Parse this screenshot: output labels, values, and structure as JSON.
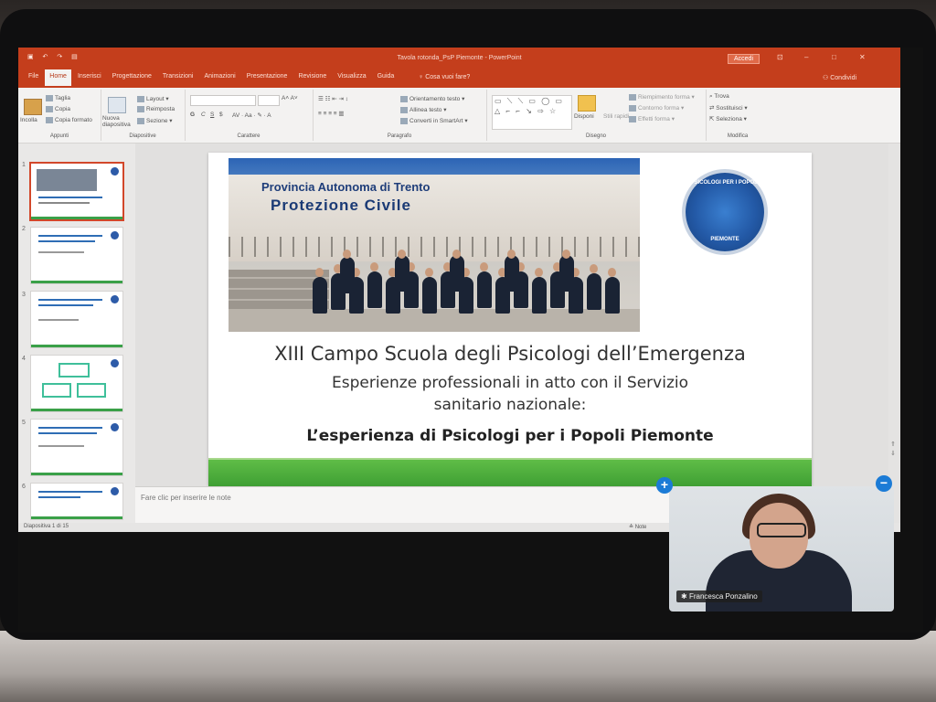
{
  "window": {
    "title": "Tavola rotonda_PsP Piemonte - PowerPoint",
    "signin_label": "Accedi",
    "share_label": "Condividi",
    "tell_me": "Cosa vuoi fare?"
  },
  "tabs": [
    {
      "label": "File"
    },
    {
      "label": "Home"
    },
    {
      "label": "Inserisci"
    },
    {
      "label": "Progettazione"
    },
    {
      "label": "Transizioni"
    },
    {
      "label": "Animazioni"
    },
    {
      "label": "Presentazione"
    },
    {
      "label": "Revisione"
    },
    {
      "label": "Visualizza"
    },
    {
      "label": "Guida"
    }
  ],
  "ribbon": {
    "clipboard": {
      "paste": "Incolla",
      "cut": "Taglia",
      "copy": "Copia",
      "format": "Copia formato",
      "group": "Appunti"
    },
    "slides": {
      "new": "Nuova diapositiva",
      "layout": "Layout",
      "reset": "Reimposta",
      "section": "Sezione",
      "group": "Diapositive"
    },
    "font": {
      "bold": "G",
      "italic": "C",
      "strike": "S",
      "shadow": "$",
      "group": "Carattere"
    },
    "paragraph": {
      "direction": "Orientamento testo",
      "align": "Allinea testo",
      "smartart": "Converti in SmartArt",
      "group": "Paragrafo"
    },
    "drawing": {
      "arrange": "Disponi",
      "styles": "Stili rapidi",
      "fill": "Riempimento forma",
      "outline": "Contorno forma",
      "effects": "Effetti forma",
      "group": "Disegno"
    },
    "editing": {
      "find": "Trova",
      "replace": "Sostituisci",
      "select": "Seleziona",
      "group": "Modifica"
    }
  },
  "thumbnails": [
    {
      "num": "1",
      "active": true
    },
    {
      "num": "2",
      "active": false
    },
    {
      "num": "3",
      "active": false
    },
    {
      "num": "4",
      "active": false
    },
    {
      "num": "5",
      "active": false
    },
    {
      "num": "6",
      "active": false
    }
  ],
  "slide": {
    "sign_line1": "Provincia Autonoma di Trento",
    "sign_line2": "Protezione Civile",
    "logo_top": "PSICOLOGI PER I POPOLI",
    "logo_bottom": "PIEMONTE",
    "title": "XIII Campo Scuola degli Psicologi dell’Emergenza",
    "subtitle_line1": "Esperienze professionali in atto con il Servizio",
    "subtitle_line2": "sanitario nazionale:",
    "bold_line": "L’esperienza di Psicologi per i Popoli Piemonte",
    "footer_color": "#3e9e33"
  },
  "notes": {
    "placeholder": "Fare clic per inserire le note"
  },
  "status": {
    "slide_count": "Diapositiva 1 di 15",
    "notes_label": "Note"
  },
  "video": {
    "participant": "Francesca Ponzalino",
    "add_icon": "plus-icon",
    "minimize_icon": "minus-icon"
  },
  "colors": {
    "accent": "#c43e1c",
    "call_button": "#1b7bd6"
  }
}
